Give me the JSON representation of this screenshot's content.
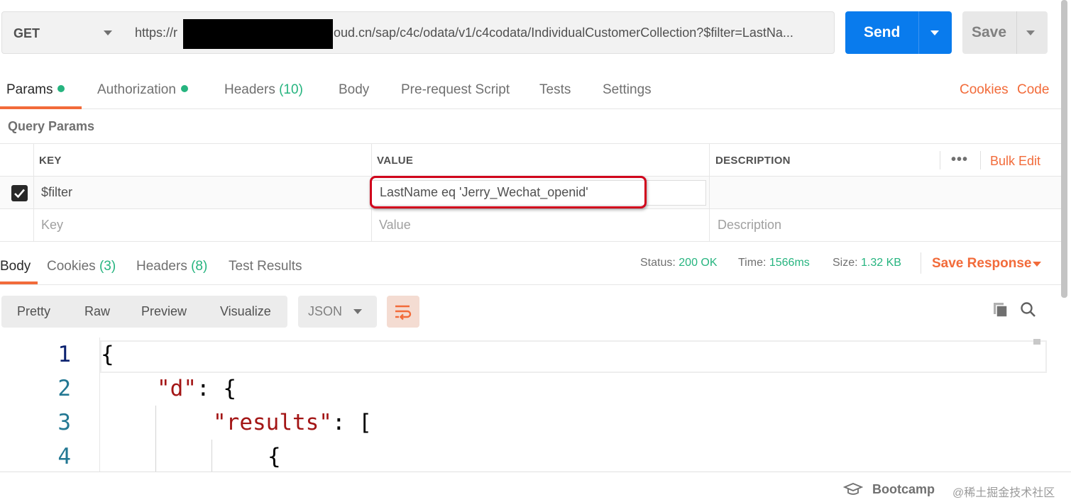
{
  "request": {
    "method": "GET",
    "url_start": "https://r",
    "url_end": "oud.cn/sap/c4c/odata/v1/c4codata/IndividualCustomerCollection?$filter=LastNa...",
    "send_label": "Send",
    "save_label": "Save"
  },
  "request_tabs": [
    {
      "label": "Params",
      "dot": true,
      "active": true
    },
    {
      "label": "Authorization",
      "dot": true
    },
    {
      "label": "Headers",
      "count": "(10)"
    },
    {
      "label": "Body"
    },
    {
      "label": "Pre-request Script"
    },
    {
      "label": "Tests"
    },
    {
      "label": "Settings"
    }
  ],
  "request_links": {
    "cookies": "Cookies",
    "code": "Code"
  },
  "query_params": {
    "title": "Query Params",
    "columns": {
      "key": "KEY",
      "value": "VALUE",
      "description": "DESCRIPTION"
    },
    "bulk_edit": "Bulk Edit",
    "more": "•••",
    "rows": [
      {
        "checked": true,
        "key": "$filter",
        "value": "LastName eq 'Jerry_Wechat_openid'",
        "description": ""
      }
    ],
    "placeholders": {
      "key": "Key",
      "value": "Value",
      "description": "Description"
    }
  },
  "response_tabs": [
    {
      "label": "Body",
      "active": true
    },
    {
      "label": "Cookies",
      "count": "(3)"
    },
    {
      "label": "Headers",
      "count": "(8)"
    },
    {
      "label": "Test Results"
    }
  ],
  "response_meta": {
    "status_label": "Status:",
    "status_value": "200 OK",
    "time_label": "Time:",
    "time_value": "1566ms",
    "size_label": "Size:",
    "size_value": "1.32 KB",
    "save_response": "Save Response"
  },
  "view_modes": [
    "Pretty",
    "Raw",
    "Preview",
    "Visualize"
  ],
  "format": "JSON",
  "editor": {
    "lines": [
      {
        "num": "1",
        "text": "{"
      },
      {
        "num": "2",
        "key": "\"d\"",
        "rest": ": {"
      },
      {
        "num": "3",
        "key": "\"results\"",
        "rest": ": ["
      },
      {
        "num": "4",
        "text": "{"
      }
    ]
  },
  "status_bar": {
    "bootcamp": "Bootcamp",
    "watermark": "@稀土掘金技术社区"
  },
  "colors": {
    "accent": "#f26b3a",
    "send": "#097bed",
    "success": "#26b47f",
    "highlight": "#d0021b"
  }
}
